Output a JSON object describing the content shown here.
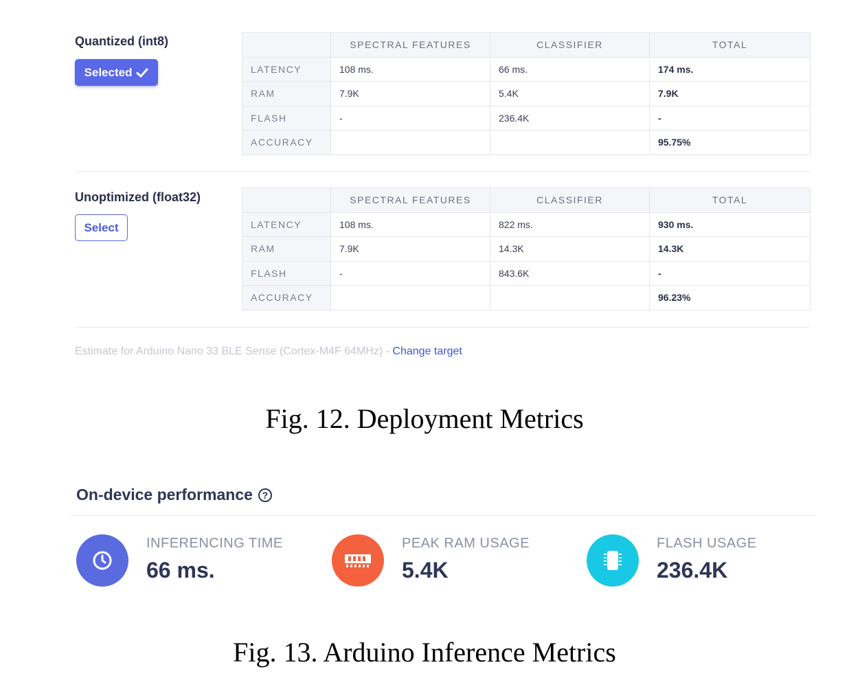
{
  "models": [
    {
      "title": "Quantized (int8)",
      "button_label": "Selected",
      "button_state": "selected",
      "columns": [
        "",
        "SPECTRAL FEATURES",
        "CLASSIFIER",
        "TOTAL"
      ],
      "rows": [
        {
          "label": "LATENCY",
          "spectral": "108 ms.",
          "classifier": "66 ms.",
          "total": "174 ms."
        },
        {
          "label": "RAM",
          "spectral": "7.9K",
          "classifier": "5.4K",
          "total": "7.9K"
        },
        {
          "label": "FLASH",
          "spectral": "-",
          "classifier": "236.4K",
          "total": "-"
        },
        {
          "label": "ACCURACY",
          "spectral": "",
          "classifier": "",
          "total": "95.75%"
        }
      ]
    },
    {
      "title": "Unoptimized (float32)",
      "button_label": "Select",
      "button_state": "unselected",
      "columns": [
        "",
        "SPECTRAL FEATURES",
        "CLASSIFIER",
        "TOTAL"
      ],
      "rows": [
        {
          "label": "LATENCY",
          "spectral": "108 ms.",
          "classifier": "822 ms.",
          "total": "930 ms."
        },
        {
          "label": "RAM",
          "spectral": "7.9K",
          "classifier": "14.3K",
          "total": "14.3K"
        },
        {
          "label": "FLASH",
          "spectral": "-",
          "classifier": "843.6K",
          "total": "-"
        },
        {
          "label": "ACCURACY",
          "spectral": "",
          "classifier": "",
          "total": "96.23%"
        }
      ]
    }
  ],
  "estimate": {
    "text": "Estimate for Arduino Nano 33 BLE Sense (Cortex-M4F 64MHz) - ",
    "link": "Change target"
  },
  "captions": {
    "fig12": "Fig. 12.  Deployment Metrics",
    "fig13": "Fig. 13.  Arduino Inference Metrics"
  },
  "performance": {
    "title": "On-device performance",
    "help_symbol": "?",
    "metrics": [
      {
        "label": "INFERENCING TIME",
        "value": "66 ms.",
        "icon": "clock-icon",
        "color": "#5a6be0"
      },
      {
        "label": "PEAK RAM USAGE",
        "value": "5.4K",
        "icon": "ram-icon",
        "color": "#f4613f"
      },
      {
        "label": "FLASH USAGE",
        "value": "236.4K",
        "icon": "chip-icon",
        "color": "#19c8e4"
      }
    ]
  },
  "colors": {
    "accent": "#5868e6",
    "link": "#3f56d6"
  }
}
